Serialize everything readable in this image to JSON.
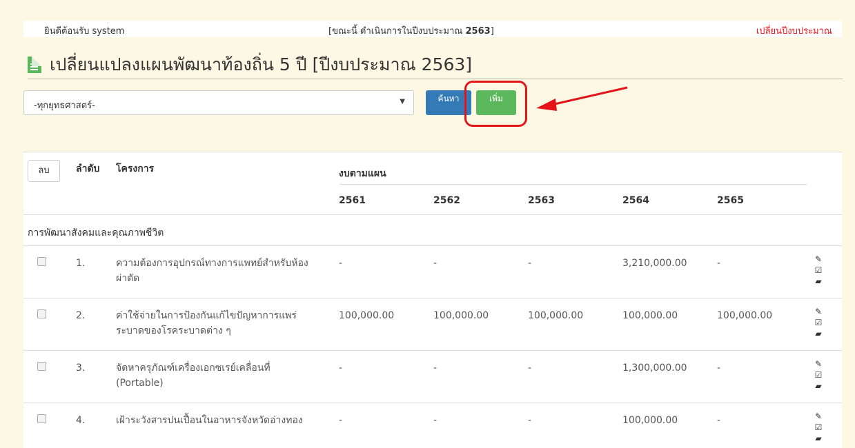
{
  "topbar": {
    "welcome": "ยินดีต้อนรับ system",
    "current_prefix": "[ขณะนี้ ดำเนินการในปีงบประมาณ ",
    "current_year": "2563",
    "current_suffix": "]",
    "change_year": "เปลี่ยนปีงบประมาณ"
  },
  "page_title": "เปลี่ยนแปลงแผนพัฒนาท้องถิ่น 5 ปี [ปีงบประมาณ 2563]",
  "filter": {
    "strategy_selected": "-ทุกยุทธศาสตร์-",
    "search_label": "ค้นหา",
    "add_label": "เพิ่ม"
  },
  "table": {
    "delete_label": "ลบ",
    "col_order": "ลำดับ",
    "col_project": "โครงการ",
    "col_budget": "งบตามแผน",
    "years": [
      "2561",
      "2562",
      "2563",
      "2564",
      "2565"
    ],
    "section": "การพัฒนาสังคมและคุณภาพชีวิต",
    "rows": [
      {
        "no": "1.",
        "name": "ความต้องการอุปกรณ์ทางการแพทย์สำหรับห้องผ่าตัด",
        "b2561": "-",
        "b2562": "-",
        "b2563": "-",
        "b2564": "3,210,000.00",
        "b2565": "-"
      },
      {
        "no": "2.",
        "name": "ค่าใช้จ่ายในการป้องกันแก้ไขปัญหาการแพร่ระบาดของโรคระบาดต่าง ๆ",
        "b2561": "100,000.00",
        "b2562": "100,000.00",
        "b2563": "100,000.00",
        "b2564": "100,000.00",
        "b2565": "100,000.00"
      },
      {
        "no": "3.",
        "name": "จัดหาครุภัณฑ์เครื่องเอกซเรย์เคลื่อนที่ (Portable)",
        "b2561": "-",
        "b2562": "-",
        "b2563": "-",
        "b2564": "1,300,000.00",
        "b2565": "-"
      },
      {
        "no": "4.",
        "name": "เฝ้าระวังสารปนเปื้อนในอาหารจังหวัดอ่างทอง",
        "b2561": "-",
        "b2562": "-",
        "b2563": "-",
        "b2564": "100,000.00",
        "b2565": "-"
      }
    ]
  },
  "icons": {
    "edit": "pencil-icon",
    "edit_detail": "edit-square-icon",
    "erase": "eraser-icon"
  },
  "colors": {
    "background": "#fdf8e4",
    "primary": "#337ab7",
    "success": "#5cb85c",
    "danger": "#e4141b"
  }
}
